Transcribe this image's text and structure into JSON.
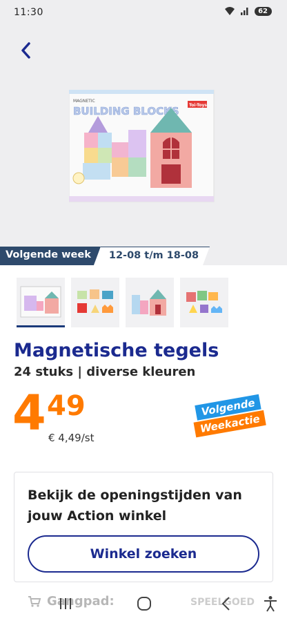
{
  "status_bar": {
    "time": "11:30",
    "battery": "62"
  },
  "hero": {
    "box_brand_small": "MAGNETIC",
    "box_title": "BUILDING BLOCKS",
    "box_logo": "Toi-Toys"
  },
  "week_banner": {
    "label": "Volgende week",
    "dates": "12-08 t/m 18-08"
  },
  "product": {
    "title": "Magnetische tegels",
    "subtitle": "24 stuks | diverse kleuren",
    "price_whole": "4",
    "price_cents": "49",
    "unit_price": "€ 4,49/st"
  },
  "sticker": {
    "line1": "Volgende",
    "line2": "Weekactie"
  },
  "store_card": {
    "text": "Bekijk de openingstijden van jouw Action winkel",
    "button_label": "Winkel zoeken"
  },
  "aisle": {
    "label": "Gangpad:",
    "value": "SPEELGOED"
  },
  "colors": {
    "brand_blue": "#1b2a8f",
    "price_orange": "#ff7a00",
    "banner_navy": "#2e4a6c",
    "sticker_blue": "#2196e6"
  }
}
